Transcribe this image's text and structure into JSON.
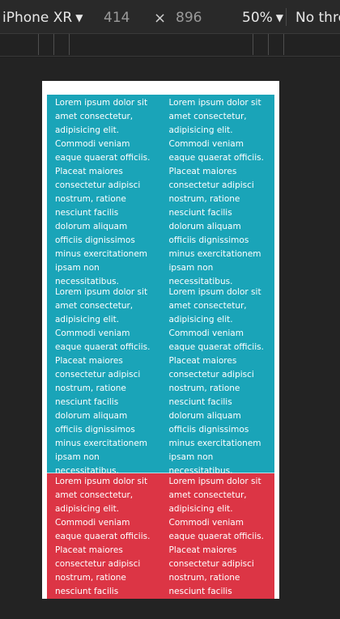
{
  "toolbar": {
    "device": "iPhone XR",
    "width": "414",
    "times": "×",
    "height": "896",
    "zoom": "50%",
    "throttle": "No thro"
  },
  "page": {
    "paragraph": "Lorem ipsum dolor sit amet consectetur, adipisicing elit. Commodi veniam eaque quaerat officiis. Placeat maiores consectetur adipisci nostrum, ratione nesciunt facilis dolorum aliquam officiis dignissimos minus exercitationem ipsam non necessitatibus.",
    "paragraph_truncated": "Lorem ipsum dolor sit amet consectetur, adipisicing elit. Commodi veniam eaque quaerat officiis. Placeat maiores consectetur adipisci nostrum, ratione nesciunt facilis dolorum"
  },
  "colors": {
    "teal": "#1aa4b8",
    "red": "#dc3545",
    "toolbar_bg": "#292929",
    "canvas_bg": "#232323"
  }
}
